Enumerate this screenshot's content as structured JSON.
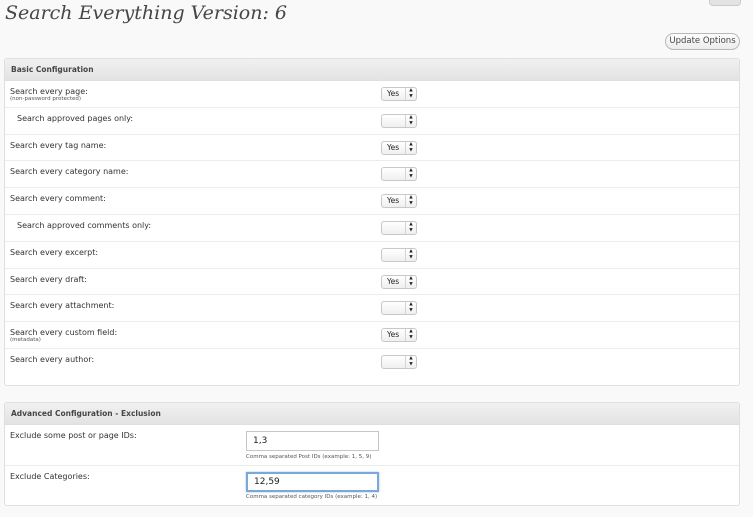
{
  "title": "Search Everything Version: 6",
  "update_button": "Update Options",
  "basic": {
    "header": "Basic Configuration",
    "rows": [
      {
        "label": "Search every page:",
        "note": "(non-password protected)",
        "value": "Yes",
        "indent": false
      },
      {
        "label": "Search approved pages only:",
        "note": "",
        "value": "",
        "indent": true
      },
      {
        "label": "Search every tag name:",
        "note": "",
        "value": "Yes",
        "indent": false
      },
      {
        "label": "Search every category name:",
        "note": "",
        "value": "",
        "indent": false
      },
      {
        "label": "Search every comment:",
        "note": "",
        "value": "Yes",
        "indent": false
      },
      {
        "label": "Search approved comments only:",
        "note": "",
        "value": "",
        "indent": true
      },
      {
        "label": "Search every excerpt:",
        "note": "",
        "value": "",
        "indent": false
      },
      {
        "label": "Search every draft:",
        "note": "",
        "value": "Yes",
        "indent": false
      },
      {
        "label": "Search every attachment:",
        "note": "",
        "value": "",
        "indent": false
      },
      {
        "label": "Search every custom field:",
        "note": "(metadata)",
        "value": "Yes",
        "indent": false
      },
      {
        "label": "Search every author:",
        "note": "",
        "value": "",
        "indent": false
      }
    ]
  },
  "advanced": {
    "header": "Advanced Configuration - Exclusion",
    "exclude_posts": {
      "label": "Exclude some post or page IDs:",
      "value": "1,3",
      "hint": "Comma separated Post IDs (example: 1, 5, 9)"
    },
    "exclude_categories": {
      "label": "Exclude Categories:",
      "value": "12,59",
      "hint": "Comma separated category IDs (example: 1, 4)"
    }
  },
  "icons": {
    "select_arrows": "up-down-arrows-icon"
  }
}
